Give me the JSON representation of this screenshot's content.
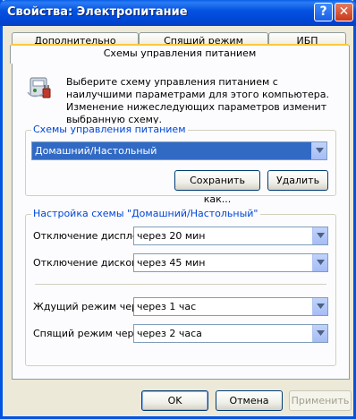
{
  "window": {
    "title": "Свойства: Электропитание",
    "help_label": "?",
    "close_label": "✕"
  },
  "tabs": [
    {
      "label": "Дополнительно"
    },
    {
      "label": "Спящий режим"
    },
    {
      "label": "ИБП"
    },
    {
      "label": "Схемы управления питанием"
    }
  ],
  "intro": {
    "text": "Выберите схему управления питанием с наилучшими параметрами для этого компьютера. Изменение нижеследующих параметров изменит выбранную схему."
  },
  "schemes": {
    "group_title": "Схемы управления питанием",
    "selected": "Домашний/Настольный",
    "save_as_label": "Сохранить как...",
    "delete_label": "Удалить"
  },
  "settings": {
    "group_title": "Настройка схемы \"Домашний/Настольный\"",
    "monitor_label": "Отключение дисплея:",
    "monitor_value": "через 20 мин",
    "disks_label": "Отключение дисков:",
    "disks_value": "через 45 мин",
    "standby_label": "Ждущий режим через:",
    "standby_value": "через 1 час",
    "hibernate_label": "Спящий режим через:",
    "hibernate_value": "через 2 часа"
  },
  "footer": {
    "ok_label": "OK",
    "cancel_label": "Отмена",
    "apply_label": "Применить"
  },
  "colors": {
    "titlebar": "#0054e3",
    "group_title": "#0046d5",
    "selection": "#316ac5"
  }
}
